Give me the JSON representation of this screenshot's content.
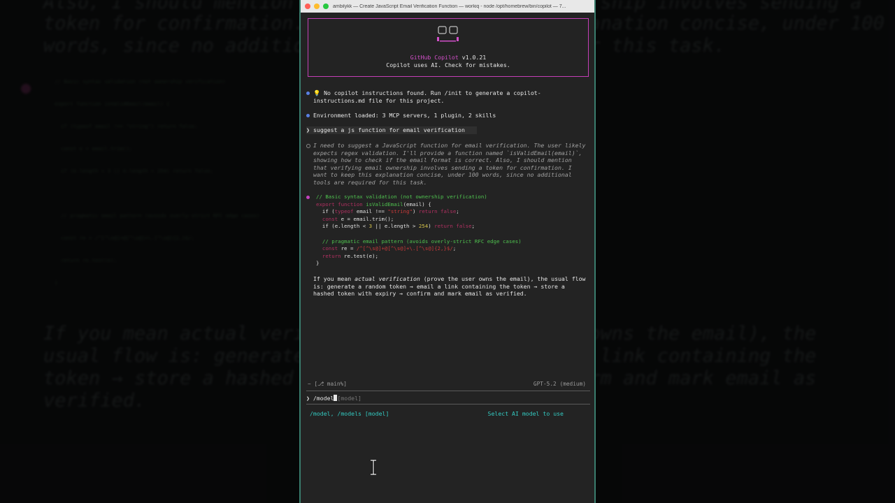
{
  "window": {
    "title": "ambilykk — Create JavaScript Email Verification Function — workiq - node /opt/homebrew/bin/copilot — 7..."
  },
  "banner": {
    "name": "GitHub Copilot",
    "version": "v1.0.21",
    "notice": "Copilot uses AI. Check for mistakes."
  },
  "messages": {
    "no_instructions": "💡 No copilot instructions found. Run /init to generate a copilot-instructions.md file for this project.",
    "environment": "Environment loaded: 3 MCP servers, 1 plugin, 2 skills",
    "user_prompt": "suggest a js function for email verification",
    "reasoning": "I need to suggest a JavaScript function for email verification. The user likely expects regex validation. I'll provide a function named `isValidEmail(email)`, showing how to check if the email format is correct. Also, I should mention that verifying email ownership involves sending a token for confirmation. I want to keep this explanation concise, under 100 words, since no additional tools are required for this task.",
    "answer_pre": "If you mean ",
    "answer_em": "actual verification",
    "answer_post": " (prove the user owns the email), the usual flow is: generate a random token → email a link containing the token → store a hashed token with expiry → confirm and mark email as verified."
  },
  "code": {
    "comment1": "// Basic syntax validation (not ownership verification)",
    "l1_kw": "export function",
    "l1_fn": "isValidEmail",
    "l1_rest": "(email) {",
    "l2_a": "if (",
    "l2_kw": "typeof",
    "l2_b": " email !== ",
    "l2_str": "\"string\"",
    "l2_c": ") ",
    "l2_ret": "return false",
    "l2_d": ";",
    "l3_kw": "const",
    "l3_rest": " e = email.trim();",
    "l4_a": "if (e.length < ",
    "l4_n1": "3",
    "l4_b": " || e.length > ",
    "l4_n2": "254",
    "l4_c": ") ",
    "l4_ret": "return false",
    "l4_d": ";",
    "comment2": "// pragmatic email pattern (avoids overly-strict RFC edge cases)",
    "l5_kw": "const",
    "l5_a": " re = ",
    "l5_str": "/^[^\\s@]+@[^\\s@]+\\.[^\\s@]{2,}$/",
    "l5_b": ";",
    "l6_kw": "return",
    "l6_rest": " re.test(e);",
    "close": "}"
  },
  "status": {
    "cwd": "~ [⎇ main%]",
    "model": "GPT-5.2 (medium)"
  },
  "input": {
    "chevron": "❯",
    "value": "/model",
    "hint": "[model]"
  },
  "suggestion": {
    "command": "/model, /models [model]",
    "description": "Select AI model to use"
  },
  "background": {
    "line1": "Also, I should mention that verifying email ownership involves sending a",
    "line2": "token for confirmation. I want to keep this explanation concise, under 100",
    "line3": "words, since no additional tools are required for this task.",
    "code1": "// Basic syntax validation (not ownership verification)",
    "code2": "export function isValidEmail(email) {",
    "code3": "  if (typeof email !== \"string\") return false;",
    "code4": "  const e = email.trim();",
    "code5": "  if (e.length < 3 || e.length > 254) return false;",
    "code6": "  // pragmatic email pattern (avoids overly-strict RFC edge cases)",
    "code7": "  const re = /^[^\\s@]+@[^\\s@]+\\.[^\\s@]{2,}$/;",
    "code8": "  return re.test(e);",
    "code9": "}",
    "ans1": "If you mean actual verification (prove the user owns the email), the",
    "ans2": "usual flow is: generate a random token → email a link containing the",
    "ans3": "token → store a hashed token with expiry → confirm and mark email as",
    "ans4": "verified."
  }
}
